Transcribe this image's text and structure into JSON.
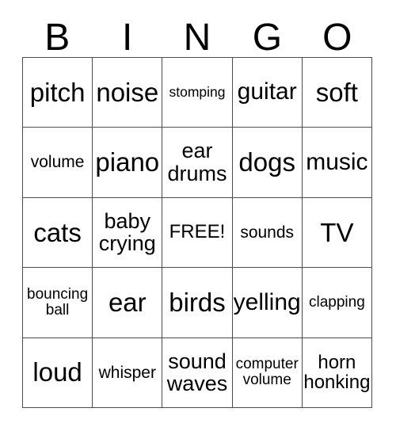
{
  "card": {
    "title": "BINGO",
    "header_letters": [
      "B",
      "I",
      "N",
      "G",
      "O"
    ],
    "free_space_label": "FREE!",
    "free_space_position": {
      "row": 3,
      "column": 3
    },
    "grid_size": "5x5",
    "colors": {
      "background": "#ffffff",
      "text": "#000000",
      "grid_line": "#4d4d4d"
    },
    "rows": [
      {
        "cells": [
          {
            "text": "pitch",
            "size": "xxl",
            "lines": 1
          },
          {
            "text": "noise",
            "size": "xxl",
            "lines": 1
          },
          {
            "text": "stomping",
            "size": "xxs",
            "lines": 1
          },
          {
            "text": "guitar",
            "size": "xl",
            "lines": 1
          },
          {
            "text": "soft",
            "size": "xxl",
            "lines": 1
          }
        ]
      },
      {
        "cells": [
          {
            "text": "volume",
            "size": "sm",
            "lines": 1
          },
          {
            "text": "piano",
            "size": "xxl",
            "lines": 1
          },
          {
            "text": "ear\ndrums",
            "size": "lg",
            "lines": 2
          },
          {
            "text": "dogs",
            "size": "xxl",
            "lines": 1
          },
          {
            "text": "music",
            "size": "xl",
            "lines": 1
          }
        ]
      },
      {
        "cells": [
          {
            "text": "cats",
            "size": "xxl",
            "lines": 1
          },
          {
            "text": "baby\ncrying",
            "size": "lg",
            "lines": 2
          },
          {
            "text": "FREE!",
            "size": "md",
            "lines": 1
          },
          {
            "text": "sounds",
            "size": "sm",
            "lines": 1
          },
          {
            "text": "TV",
            "size": "xxl",
            "lines": 1
          }
        ]
      },
      {
        "cells": [
          {
            "text": "bouncing\nball",
            "size": "xs",
            "lines": 2
          },
          {
            "text": "ear",
            "size": "xxl",
            "lines": 1
          },
          {
            "text": "birds",
            "size": "xxl",
            "lines": 1
          },
          {
            "text": "yelling",
            "size": "xl",
            "lines": 1
          },
          {
            "text": "clapping",
            "size": "xs",
            "lines": 1
          }
        ]
      },
      {
        "cells": [
          {
            "text": "loud",
            "size": "xxl",
            "lines": 1
          },
          {
            "text": "whisper",
            "size": "sm",
            "lines": 1
          },
          {
            "text": "sound\nwaves",
            "size": "lg",
            "lines": 2
          },
          {
            "text": "computer\nvolume",
            "size": "xs",
            "lines": 2
          },
          {
            "text": "horn\nhonking",
            "size": "md",
            "lines": 2
          }
        ]
      }
    ]
  }
}
